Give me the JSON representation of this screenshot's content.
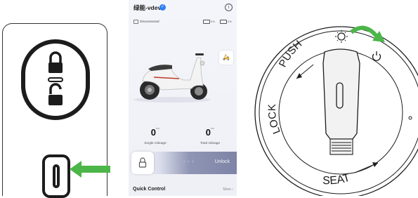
{
  "app": {
    "title": "绿能-vdevo",
    "status": "Disconnected",
    "battery_1": "0%",
    "battery_2": "0%",
    "single_mileage": {
      "value": "0",
      "unit": "km",
      "label": "Single mileage"
    },
    "total_mileage": {
      "value": "0",
      "unit": "km",
      "label": "Total mileage"
    },
    "unlock_label": "Unlock",
    "unlock_chevrons": "› › ›",
    "quick_control": "Quick Control",
    "more": "More ›"
  },
  "dial": {
    "push": "PUSH",
    "lock": "LOCK",
    "seat": "SEAT"
  },
  "colors": {
    "arrow_green": "#4cb648",
    "accent_blue": "#2f7df6",
    "ink": "#1c1c1c"
  },
  "icons": [
    "padlock-closed-icon",
    "padlock-open-icon",
    "key-slot-icon",
    "helmet-scooter-icon",
    "info-icon",
    "lock-icon",
    "sun-icon",
    "power-icon"
  ]
}
